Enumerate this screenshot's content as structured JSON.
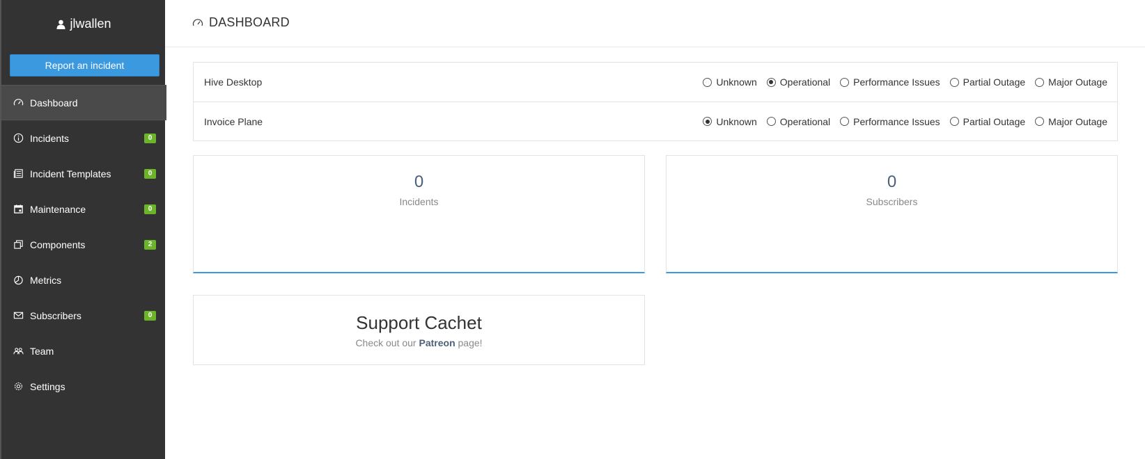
{
  "sidebar": {
    "username": "jlwallen",
    "report_button": "Report an incident",
    "items": [
      {
        "label": "Dashboard",
        "icon": "dashboard-icon",
        "badge": null,
        "active": true
      },
      {
        "label": "Incidents",
        "icon": "info-icon",
        "badge": "0"
      },
      {
        "label": "Incident Templates",
        "icon": "template-icon",
        "badge": "0"
      },
      {
        "label": "Maintenance",
        "icon": "calendar-icon",
        "badge": "0"
      },
      {
        "label": "Components",
        "icon": "components-icon",
        "badge": "2"
      },
      {
        "label": "Metrics",
        "icon": "pie-chart-icon",
        "badge": null
      },
      {
        "label": "Subscribers",
        "icon": "envelope-icon",
        "badge": "0"
      },
      {
        "label": "Team",
        "icon": "team-icon",
        "badge": null
      },
      {
        "label": "Settings",
        "icon": "gear-icon",
        "badge": null
      }
    ]
  },
  "header": {
    "title": "DASHBOARD",
    "icon": "dashboard-icon"
  },
  "status_options": [
    "Unknown",
    "Operational",
    "Performance Issues",
    "Partial Outage",
    "Major Outage"
  ],
  "components": [
    {
      "name": "Hive Desktop",
      "selected": "Operational"
    },
    {
      "name": "Invoice Plane",
      "selected": "Unknown"
    }
  ],
  "stats": {
    "incidents": {
      "value": "0",
      "label": "Incidents"
    },
    "subscribers": {
      "value": "0",
      "label": "Subscribers"
    }
  },
  "support": {
    "title": "Support Cachet",
    "text_before": "Check out our ",
    "link": "Patreon",
    "text_after": " page!"
  },
  "colors": {
    "sidebar_bg": "#333333",
    "accent": "#3b99e0",
    "badge": "#6cb52b"
  }
}
